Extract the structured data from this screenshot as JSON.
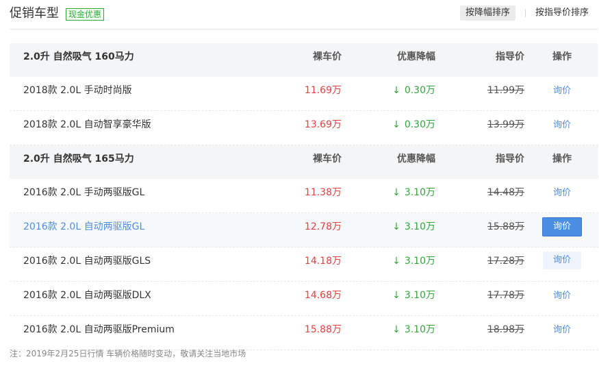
{
  "header": {
    "title": "促销车型",
    "badge": "现金优惠",
    "sort_desc_label": "按降幅排序",
    "sort_guide_label": "按指导价排序"
  },
  "columns": {
    "price": "裸车价",
    "drop": "优惠降幅",
    "guide": "指导价",
    "op": "操作"
  },
  "groups": [
    {
      "title": "2.0升 自然吸气 160马力",
      "rows": [
        {
          "name": "2018款 2.0L 手动时尚版",
          "price": "11.69万",
          "drop": "0.30万",
          "guide": "11.99万",
          "action": "询价"
        },
        {
          "name": "2018款 2.0L 自动智享豪华版",
          "price": "13.69万",
          "drop": "0.30万",
          "guide": "13.99万",
          "action": "询价"
        }
      ]
    },
    {
      "title": "2.0升 自然吸气 165马力",
      "rows": [
        {
          "name": "2016款 2.0L 手动两驱版GL",
          "price": "11.38万",
          "drop": "3.10万",
          "guide": "14.48万",
          "action": "询价"
        },
        {
          "name": "2016款 2.0L 自动两驱版GL",
          "price": "12.78万",
          "drop": "3.10万",
          "guide": "15.88万",
          "action": "询价"
        },
        {
          "name": "2016款 2.0L 自动两驱版GLS",
          "price": "14.18万",
          "drop": "3.10万",
          "guide": "17.28万",
          "action": "询价"
        },
        {
          "name": "2016款 2.0L 自动两驱版DLX",
          "price": "14.68万",
          "drop": "3.10万",
          "guide": "17.78万",
          "action": "询价"
        },
        {
          "name": "2016款 2.0L 自动两驱版Premium",
          "price": "15.88万",
          "drop": "3.10万",
          "guide": "18.98万",
          "action": "询价"
        }
      ]
    }
  ],
  "icons": {
    "drop_arrow": "arrow-down-icon"
  },
  "colors": {
    "price": "#e83e3e",
    "drop": "#2fa83a",
    "accent": "#4a8ee6"
  },
  "note": "注：2019年2月25日行情 车辆价格随时变动，敬请关注当地市场"
}
